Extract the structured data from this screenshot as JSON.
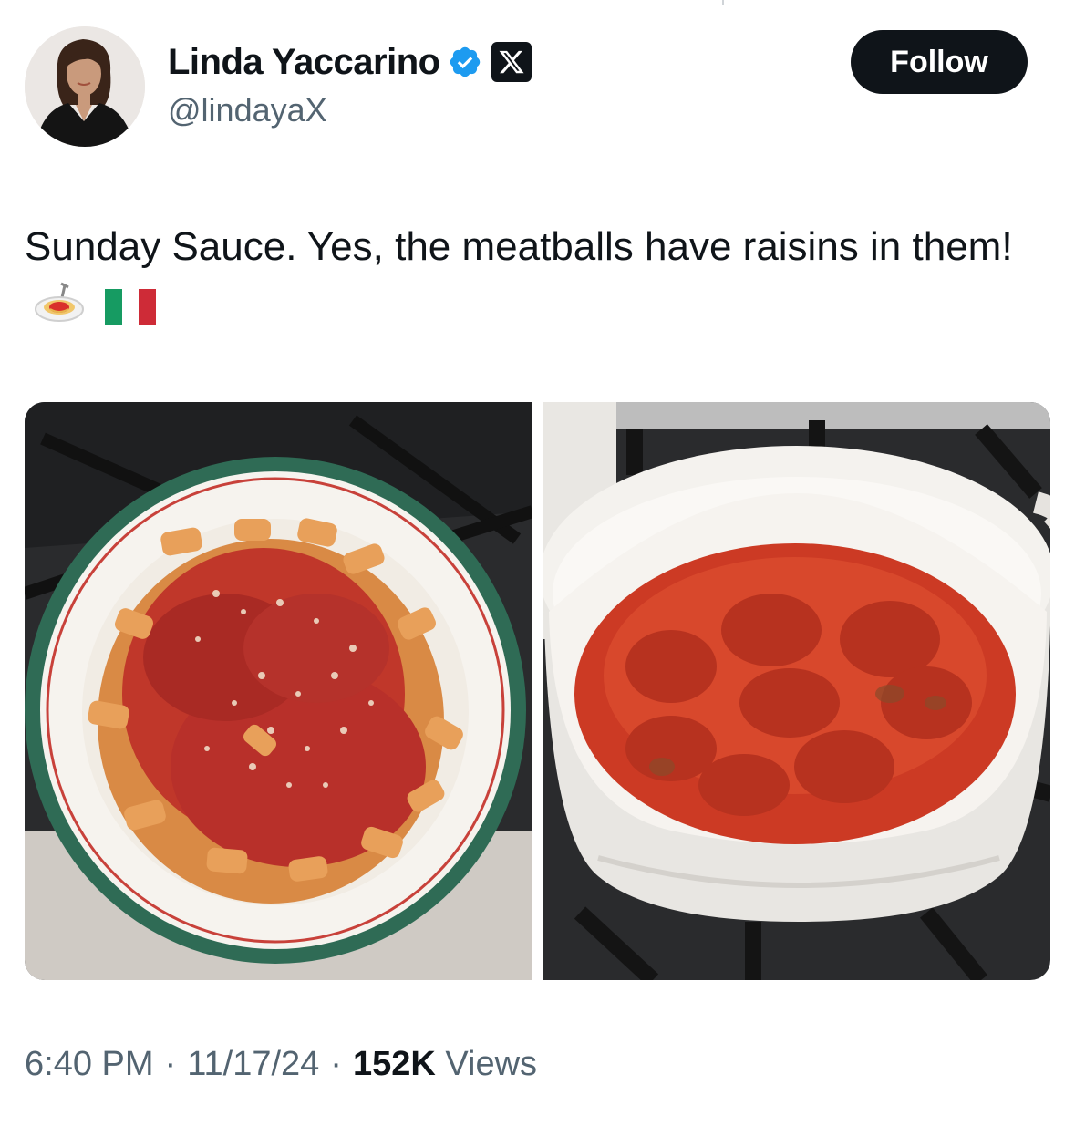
{
  "author": {
    "display_name": "Linda Yaccarino",
    "handle": "@lindayaX",
    "verified": true,
    "affiliation_badge": "x-logo-icon"
  },
  "actions": {
    "follow_label": "Follow"
  },
  "tweet": {
    "text": "Sunday Sauce. Yes, the meatballs have raisins in them!",
    "emojis": [
      "spaghetti-icon",
      "italy-flag-icon"
    ]
  },
  "media": [
    {
      "alt": "photo-pasta-bowl"
    },
    {
      "alt": "photo-sauce-pot"
    }
  ],
  "meta": {
    "time": "6:40 PM",
    "date": "11/17/24",
    "separator": "·",
    "views_count": "152K",
    "views_label": "Views"
  },
  "colors": {
    "text": "#0f1419",
    "secondary": "#536471",
    "verified": "#1d9bf0",
    "button": "#0f1419"
  }
}
